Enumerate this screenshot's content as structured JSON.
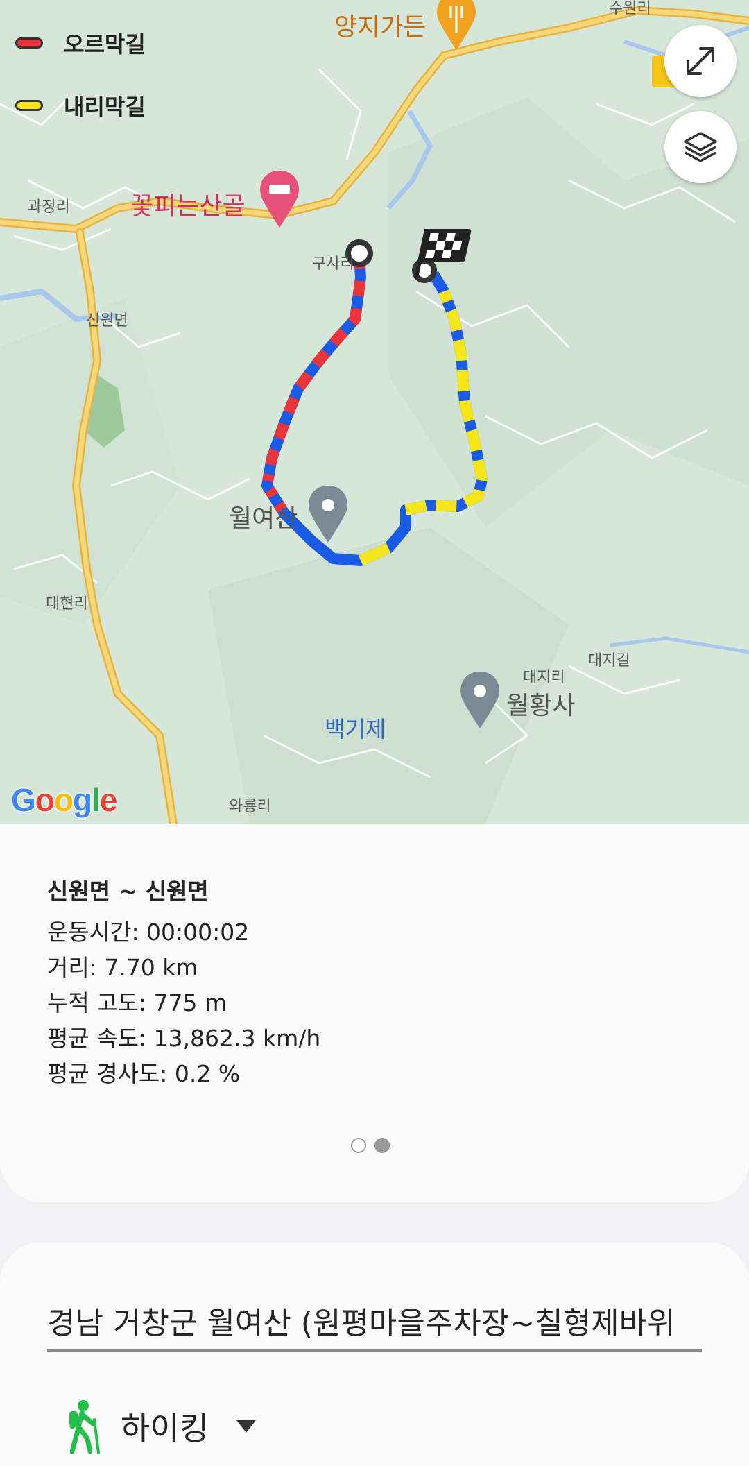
{
  "legend": {
    "uphill_label": "오르막길",
    "downhill_label": "내리막길",
    "uphill_color": "#e8343a",
    "downhill_color": "#f5e61b",
    "flat_color": "#1a5be6"
  },
  "map": {
    "places": {
      "suwonri": "수원리",
      "yangji": "양지가든",
      "kkot": "꽃피는산골",
      "gwajeong": "과정리",
      "gusa": "구사리",
      "sinwon": "신원면",
      "wolyeosan": "월여산",
      "daehyeon": "대현리",
      "baekgije": "백기제",
      "daeji": "대지리",
      "daejigil": "대지길",
      "wolhwangsa": "월황사",
      "waryong": "와룡리"
    },
    "google_logo": "Google",
    "expand_icon": "expand-icon",
    "layers_icon": "layers-icon"
  },
  "route": {
    "title": "신원면 ~ 신원면",
    "duration": "운동시간: 00:00:02",
    "distance": "거리: 7.70 km",
    "elevation": "누적 고도: 775 m",
    "speed": "평균 속도: 13,862.3 km/h",
    "slope": "평균 경사도: 0.2 %"
  },
  "pager": {
    "current": 2,
    "total": 2
  },
  "form": {
    "name_value": "경남 거창군 월여산 (원평마을주차장~칠형제바위",
    "activity_label": "하이킹",
    "activity_icon": "hiking-icon"
  }
}
